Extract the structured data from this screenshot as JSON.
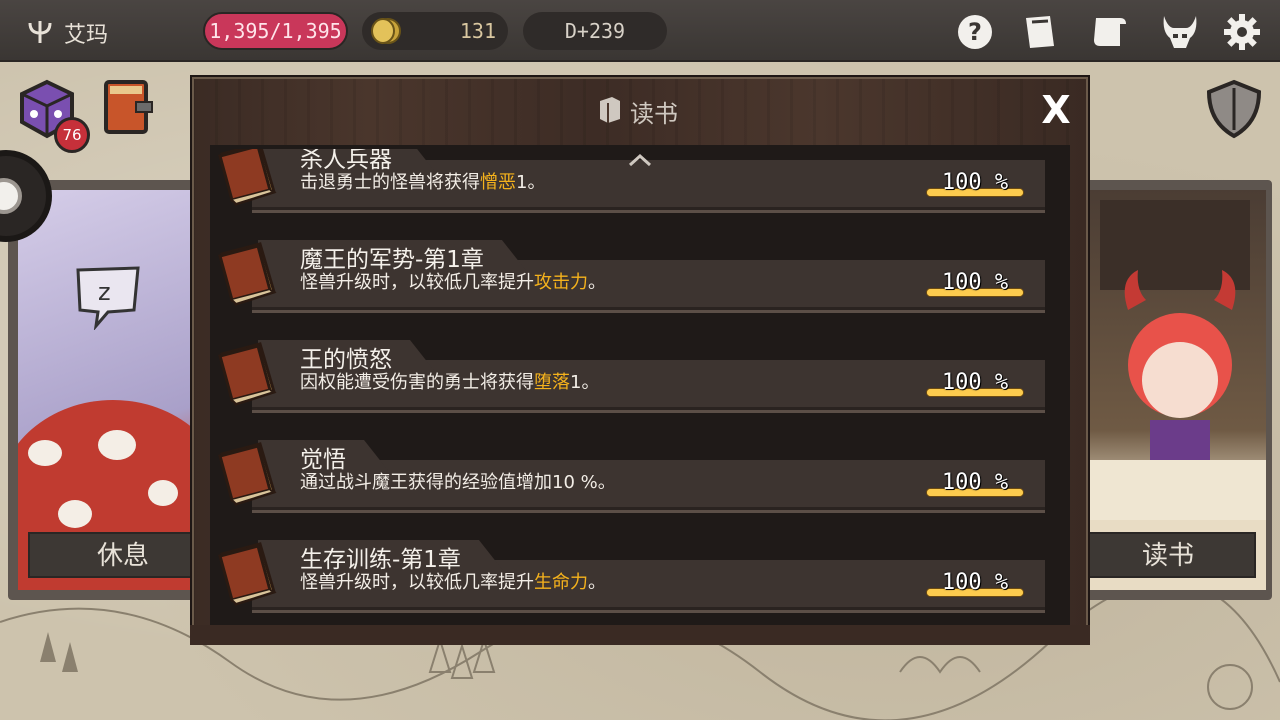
{
  "topbar": {
    "player_name": "艾玛",
    "hp": "1,395/1,395",
    "gold": "131",
    "day": "D+239",
    "icons": [
      "help-icon",
      "card-icon",
      "map-scroll-icon",
      "demon-helmet-icon",
      "gear-icon"
    ]
  },
  "side": {
    "dice_count": "76",
    "left_label": "休息",
    "right_label": "读书"
  },
  "modal": {
    "title": "读书",
    "close_label": "X",
    "entries": [
      {
        "name": "杀人兵器",
        "desc_prefix": "击退勇士的怪兽将获得",
        "desc_highlight": "憎恶",
        "desc_suffix": "1。",
        "progress_text": "100 %",
        "progress_value": 1.0
      },
      {
        "name": "魔王的军势-第1章",
        "desc_prefix": "怪兽升级时，以较低几率提升",
        "desc_highlight": "攻击力",
        "desc_suffix": "。",
        "progress_text": "100 %",
        "progress_value": 1.0
      },
      {
        "name": "王的愤怒",
        "desc_prefix": "因权能遭受伤害的勇士将获得",
        "desc_highlight": "堕落",
        "desc_suffix": "1。",
        "progress_text": "100 %",
        "progress_value": 1.0
      },
      {
        "name": "觉悟",
        "desc_prefix": "通过战斗魔王获得的经验值增加10 %。",
        "desc_highlight": "",
        "desc_suffix": "",
        "progress_text": "100 %",
        "progress_value": 1.0
      },
      {
        "name": "生存训练-第1章",
        "desc_prefix": "怪兽升级时，以较低几率提升",
        "desc_highlight": "生命力",
        "desc_suffix": "。",
        "progress_text": "100 %",
        "progress_value": 1.0
      }
    ]
  },
  "colors": {
    "highlight": "#f5b21c",
    "hp_pill": "#c9375a",
    "progress": "#f0b838"
  }
}
